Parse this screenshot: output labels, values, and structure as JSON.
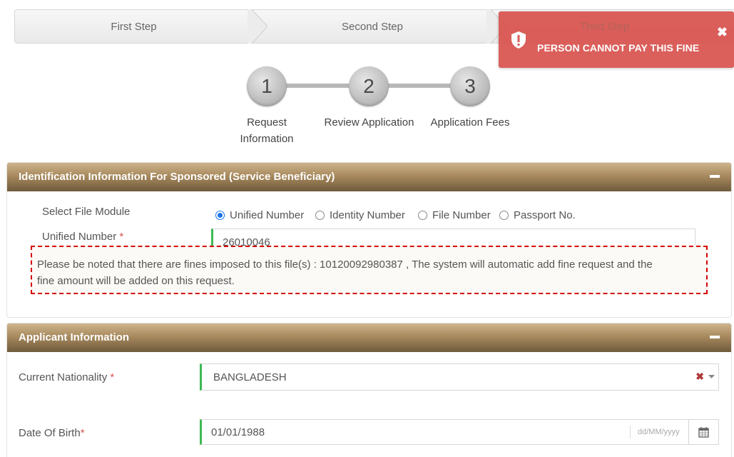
{
  "wizard": {
    "steps": [
      "First Step",
      "Second Step",
      "Third Step"
    ]
  },
  "toast": {
    "message": "PERSON CANNOT PAY THIS FINE",
    "close_glyph": "✖",
    "icon": "shield-exclamation-icon",
    "color": "#d9534f"
  },
  "progress": {
    "steps": [
      {
        "number": "1",
        "label_line1": "Request",
        "label_line2": "Information"
      },
      {
        "number": "2",
        "label": "Review Application"
      },
      {
        "number": "3",
        "label": "Application Fees"
      }
    ]
  },
  "identification": {
    "title": "Identification Information For Sponsored (Service Beneficiary)",
    "file_module_label": "Select File Module",
    "options": [
      "Unified Number",
      "Identity Number",
      "File Number",
      "Passport No."
    ],
    "selected": "Unified Number",
    "unified_label": "Unified Number",
    "required_mark": "*",
    "unified_value": "26010046",
    "notice_line1": "Please be noted that there are fines imposed to this file(s) : 10120092980387 , The system will automatic add fine request and the",
    "notice_line2": "fine amount will be added on this request."
  },
  "applicant": {
    "title": "Applicant Information",
    "nationality_label": "Current Nationality",
    "required_mark": "*",
    "nationality_value": "BANGLADESH",
    "clear_glyph": "✖",
    "dob_label": "Date Of Birth",
    "dob_value": "01/01/1988",
    "dob_placeholder": "dd/MM/yyyy"
  },
  "colors": {
    "panel_header_top": "#ceb48c",
    "panel_header_bottom": "#6f5a3c",
    "required": "#d9534f",
    "valid_border": "#3cba54",
    "notice_border": "#d40000"
  }
}
